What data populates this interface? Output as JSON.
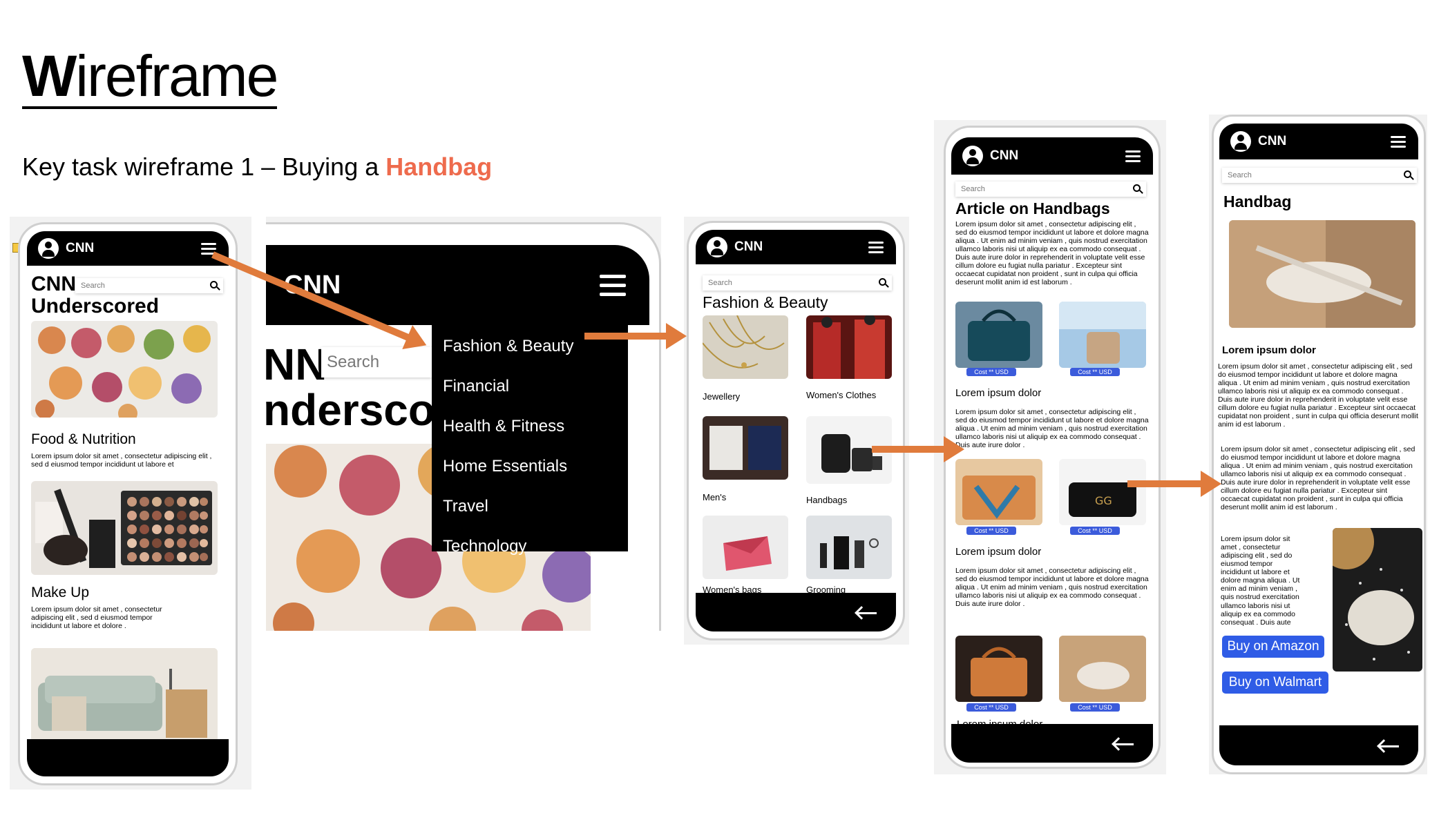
{
  "slide": {
    "title_first": "W",
    "title_rest": "ireframe",
    "subtitle_prefix": "Key task wireframe 1 – Buying a ",
    "subtitle_accent": "Handbag",
    "accent_color": "#ee6b4d",
    "arrow_color": "#e07b3c"
  },
  "app": {
    "brand": "CNN",
    "search_placeholder": "Search",
    "lorem_short": "Lorem ipsum dolor sit amet , consectetur adipiscing elit , sed d eiusmod tempor incididunt ut labore et",
    "lorem_long": "Lorem ipsum dolor sit amet , consectetur adipiscing elit , sed do eiusmod tempor incididunt ut labore et dolore magna aliqua . Ut enim ad minim veniam , quis nostrud exercitation ullamco laboris nisi ut aliquip ex ea commodo consequat . Duis aute irure dolor in reprehenderit in voluptate velit esse cillum dolore eu fugiat nulla pariatur . Excepteur sint occaecat cupidatat non proident , sunt in culpa qui officia deserunt mollit anim id est laborum ."
  },
  "screen1": {
    "heading_line1": "CNN",
    "heading_line2": "Underscored",
    "section1": "Food & Nutrition",
    "section1_text": "Lorem ipsum dolor sit amet , consectetur adipiscing elit , sed d eiusmod tempor incididunt ut labore et",
    "section2": "Make Up",
    "section2_text": "Lorem ipsum dolor sit amet , consectetur adipiscing elit , sed d eiusmod tempor incididunt ut labore et dolore ."
  },
  "screen2": {
    "brand": "CNN",
    "heading_part1": "NN",
    "heading_part2": "nderscor",
    "search": "Search",
    "menu": [
      "Fashion & Beauty",
      "Financial",
      "Health & Fitness",
      "Home Essentials",
      "Travel",
      "Technology"
    ]
  },
  "screen3": {
    "title": "Fashion & Beauty",
    "categories": [
      "Jewellery",
      "Women's Clothes",
      "Men's",
      "Handbags",
      "Women's bags",
      "Grooming"
    ]
  },
  "screen4": {
    "title": "Article on Handbags",
    "cost_label": "Cost ** USD",
    "subheading": "Lorem ipsum dolor",
    "para": "Lorem ipsum dolor sit amet , consectetur adipiscing elit , sed do eiusmod tempor incididunt ut labore et dolore magna aliqua . Ut enim ad minim veniam , quis nostrud exercitation ullamco laboris nisi ut aliquip ex ea commodo consequat . Duis aute irure dolor ."
  },
  "screen5": {
    "title": "Handbag",
    "subheading": "Lorem ipsum dolor",
    "para_narrow": "Lorem ipsum dolor sit amet , consectetur adipiscing elit , sed do eiusmod tempor incididunt ut labore et dolore magna aliqua . Ut enim ad minim veniam , quis nostrud exercitation ullamco laboris nisi ut aliquip ex ea commodo consequat . Duis aute",
    "buy_amazon": "Buy on Amazon",
    "buy_walmart": "Buy on Walmart"
  }
}
